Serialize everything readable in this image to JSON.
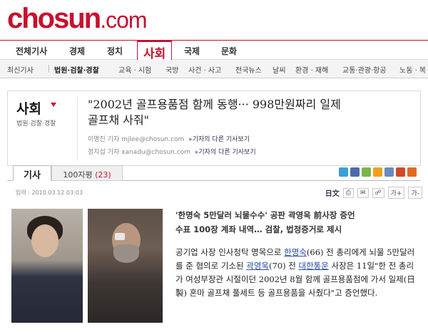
{
  "logo": {
    "main": "chosun",
    "suffix": ".com"
  },
  "nav_main": [
    {
      "label": "전체기사"
    },
    {
      "label": "경제"
    },
    {
      "label": "정치"
    },
    {
      "label": "사회"
    },
    {
      "label": "국제"
    },
    {
      "label": "문화"
    }
  ],
  "nav_sub": [
    {
      "label": "최신기사"
    },
    {
      "label": "법원·검찰·경찰"
    },
    {
      "label": "교육 · 시험"
    },
    {
      "label": "국방"
    },
    {
      "label": "사건 · 사고"
    },
    {
      "label": "전국뉴스"
    },
    {
      "label": "날씨"
    },
    {
      "label": "환경 · 재해"
    },
    {
      "label": "교통·관광·항공"
    },
    {
      "label": "노동 · 복"
    }
  ],
  "section": {
    "title": "사회",
    "subtitle": "법원·검찰·경찰"
  },
  "article": {
    "headline_line1": "\"2002년 골프용품점 함께 동행··· 998만원짜리 일제",
    "headline_line2": "골프채 사줘\"",
    "bylines": [
      {
        "name": "이명진 기자",
        "email": "mjlee@chosun.com",
        "link": "기자의 다른 기사보기"
      },
      {
        "name": "정지섭 기자",
        "email": "xanadu@chosun.com",
        "link": "기자의 다른 기사보기"
      }
    ],
    "date": "입력 : 2010.03.12 03:03",
    "subheadline_line1": "'한명숙 5만달러 뇌물수수' 공판 곽영욱 前사장 증언",
    "subheadline_line2": "수표 100장 계좌 내역… 검찰, 법정증거로 제시",
    "body": {
      "p1": "공기업 사장 인사청탁 명목으로 ",
      "link1": "한명숙",
      "p2": "(66) 전 총리에게 뇌물 5만달러를 준 혐의로 기소된 ",
      "link2": "곽영욱",
      "p3": "(70) 전 ",
      "link3": "대한통운",
      "p4": " 사장은 11일\"한 전 총리가 여성부장관 시절이던 2002년 8월 함께 골프용품점에 가서 일제(日製) 혼마 골프채 풀세트 등 골프용품을 사줬다\"고 증언했다."
    }
  },
  "tabs": {
    "article": "기사",
    "comments_label": "100자평",
    "comments_count": "(23)"
  },
  "tools": {
    "lang": "日文",
    "font_larger": "가+",
    "font_smaller": "가-"
  },
  "toolbar_icons": [
    {
      "name": "twitter-icon",
      "color": "#3aa0d8"
    },
    {
      "name": "facebook-icon",
      "color": "#4a6aa8"
    },
    {
      "name": "yozm-icon",
      "color": "#7ab648"
    },
    {
      "name": "me2day-icon",
      "color": "#f0a020"
    },
    {
      "name": "email-icon",
      "color": "#6a8ac0"
    },
    {
      "name": "print-icon",
      "color": "#d04828"
    },
    {
      "name": "scrap-icon",
      "color": "#e06a20"
    }
  ]
}
